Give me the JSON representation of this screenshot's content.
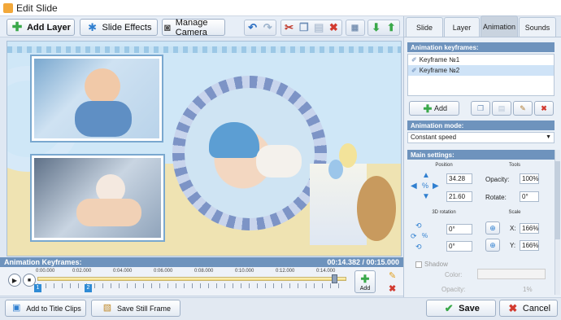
{
  "window": {
    "title": "Edit Slide"
  },
  "toolbar": {
    "add_layer": "Add Layer",
    "slide_effects": "Slide Effects",
    "manage_camera": "Manage Camera"
  },
  "timeline": {
    "header": "Animation Keyframes:",
    "time_display": "00:14.382 / 00:15.000",
    "ticks": [
      "0:00.000",
      "0:02.000",
      "0:04.000",
      "0:06.000",
      "0:08.000",
      "0:10.000",
      "0:12.000",
      "0:14.000"
    ],
    "keyframe_markers": [
      "1",
      "2"
    ],
    "add_label": "Add"
  },
  "tabs": [
    "Slide",
    "Layer",
    "Animation",
    "Sounds"
  ],
  "active_tab": "Animation",
  "animation": {
    "keyframes_header": "Animation keyframes:",
    "keyframes": [
      "Keyframe №1",
      "Keyframe №2"
    ],
    "add_label": "Add",
    "mode_header": "Animation mode:",
    "mode_value": "Constant speed",
    "main_settings_header": "Main settings:",
    "position_label": "Position",
    "pos_x": "34.28",
    "pos_y": "21.60",
    "tools_label": "Tools",
    "opacity_label": "Opacity:",
    "opacity_value": "100%",
    "rotate_label": "Rotate:",
    "rotate_value": "0°",
    "rotation3d_label": "3D rotation",
    "rot3d_1": "0°",
    "rot3d_2": "0°",
    "scale_label": "Scale",
    "scale_x_label": "X:",
    "scale_x_value": "166%",
    "scale_y_label": "Y:",
    "scale_y_value": "166%",
    "shadow_label": "Shadow",
    "shadow_color_label": "Color:",
    "shadow_opacity_label": "Opacity:",
    "shadow_opacity_value": "1%"
  },
  "bottom": {
    "add_title_clips": "Add to Title Clips",
    "save_still": "Save Still Frame",
    "save": "Save",
    "cancel": "Cancel"
  },
  "colors": {
    "accent": "#6e93bd",
    "add_green": "#3aa84a",
    "cancel_red": "#d23a2f"
  }
}
